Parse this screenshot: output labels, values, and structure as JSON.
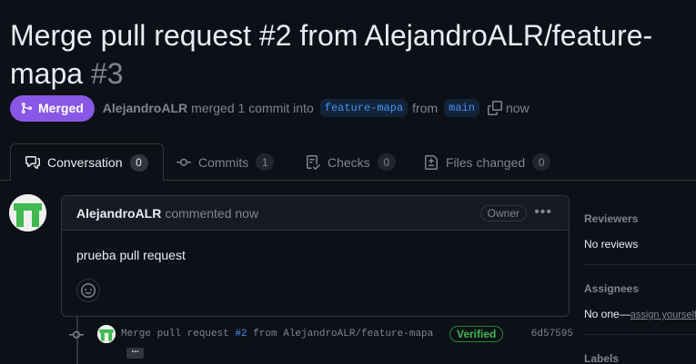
{
  "pr": {
    "title": "Merge pull request #2 from AlejandroALR/feature-mapa",
    "number": "#3",
    "state": "Merged",
    "author": "AlejandroALR",
    "action": "merged 1 commit into",
    "base_branch": "feature-mapa",
    "from": "from",
    "head_branch": "main",
    "time": "now"
  },
  "tabs": [
    {
      "label": "Conversation",
      "count": "0",
      "icon": "comment-discussion-icon"
    },
    {
      "label": "Commits",
      "count": "1",
      "icon": "git-commit-icon"
    },
    {
      "label": "Checks",
      "count": "0",
      "icon": "checklist-icon"
    },
    {
      "label": "Files changed",
      "count": "0",
      "icon": "file-diff-icon"
    }
  ],
  "comment": {
    "author": "AlejandroALR",
    "time": "commented now",
    "role": "Owner",
    "body": "prueba pull request"
  },
  "commit": {
    "message_prefix": "Merge pull request ",
    "message_link": "#2",
    "message_suffix": " from AlejandroALR/feature-mapa",
    "verified": "Verified",
    "sha": "6d57595",
    "expand": "..."
  },
  "sidebar": {
    "reviewers_label": "Reviewers",
    "reviewers_value": "No reviews",
    "assignees_label": "Assignees",
    "assignees_value": "No one—",
    "assignees_link": "assign yourself",
    "labels_label": "Labels"
  },
  "colors": {
    "merged_badge": "#8957e5",
    "link": "#4493f8",
    "verified": "#3fb950",
    "background": "#0d1117"
  }
}
